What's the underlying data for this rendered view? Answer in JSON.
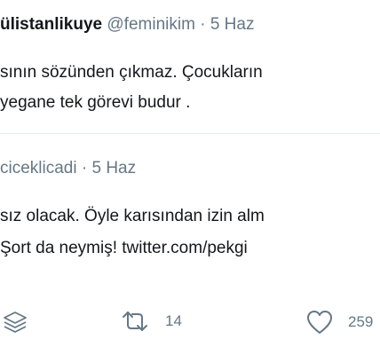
{
  "tweet": {
    "display_name": "ülistanlikuye",
    "handle": "@feminikim",
    "separator": "·",
    "date": "5 Haz",
    "lines": [
      "sının sözünden çıkmaz. Çocukların",
      "yegane tek görevi budur ."
    ]
  },
  "quoted": {
    "handle": "ciceklicadi",
    "separator": "·",
    "date": "5 Haz",
    "lines": [
      "sız olacak. Öyle karısından izin alm",
      "Şort da neymiş! twitter.com/pekgi"
    ]
  },
  "actions": {
    "stack_icon": "layers-icon",
    "retweet_icon": "retweet-icon",
    "retweet_count": "14",
    "like_icon": "heart-icon",
    "like_count": "259"
  },
  "colors": {
    "text": "#14171a",
    "secondary": "#657786",
    "divider": "#e6ecf0"
  }
}
